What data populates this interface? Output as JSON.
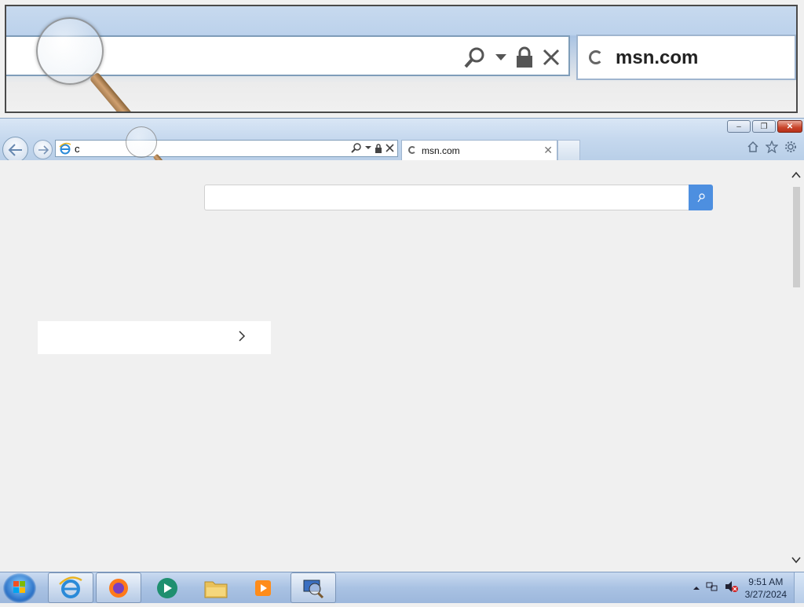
{
  "magnifier": {
    "tab_title": "msn.com"
  },
  "browser": {
    "address_value": "c",
    "address_placeholder": "",
    "tab_title": "msn.com",
    "window_controls": {
      "minimize": "–",
      "maximize": "❐",
      "close": "✕"
    }
  },
  "page": {
    "search_placeholder": "",
    "card_text": ""
  },
  "taskbar": {
    "apps": [
      "Internet Explorer",
      "Firefox",
      "Chat app",
      "File Explorer",
      "Media Player",
      "Network tool"
    ],
    "clock": {
      "time": "9:51 AM",
      "date": "3/27/2024"
    }
  },
  "colors": {
    "accent": "#4d8fe0",
    "frame": "#c5d8ee",
    "close_button": "#c9452b"
  }
}
